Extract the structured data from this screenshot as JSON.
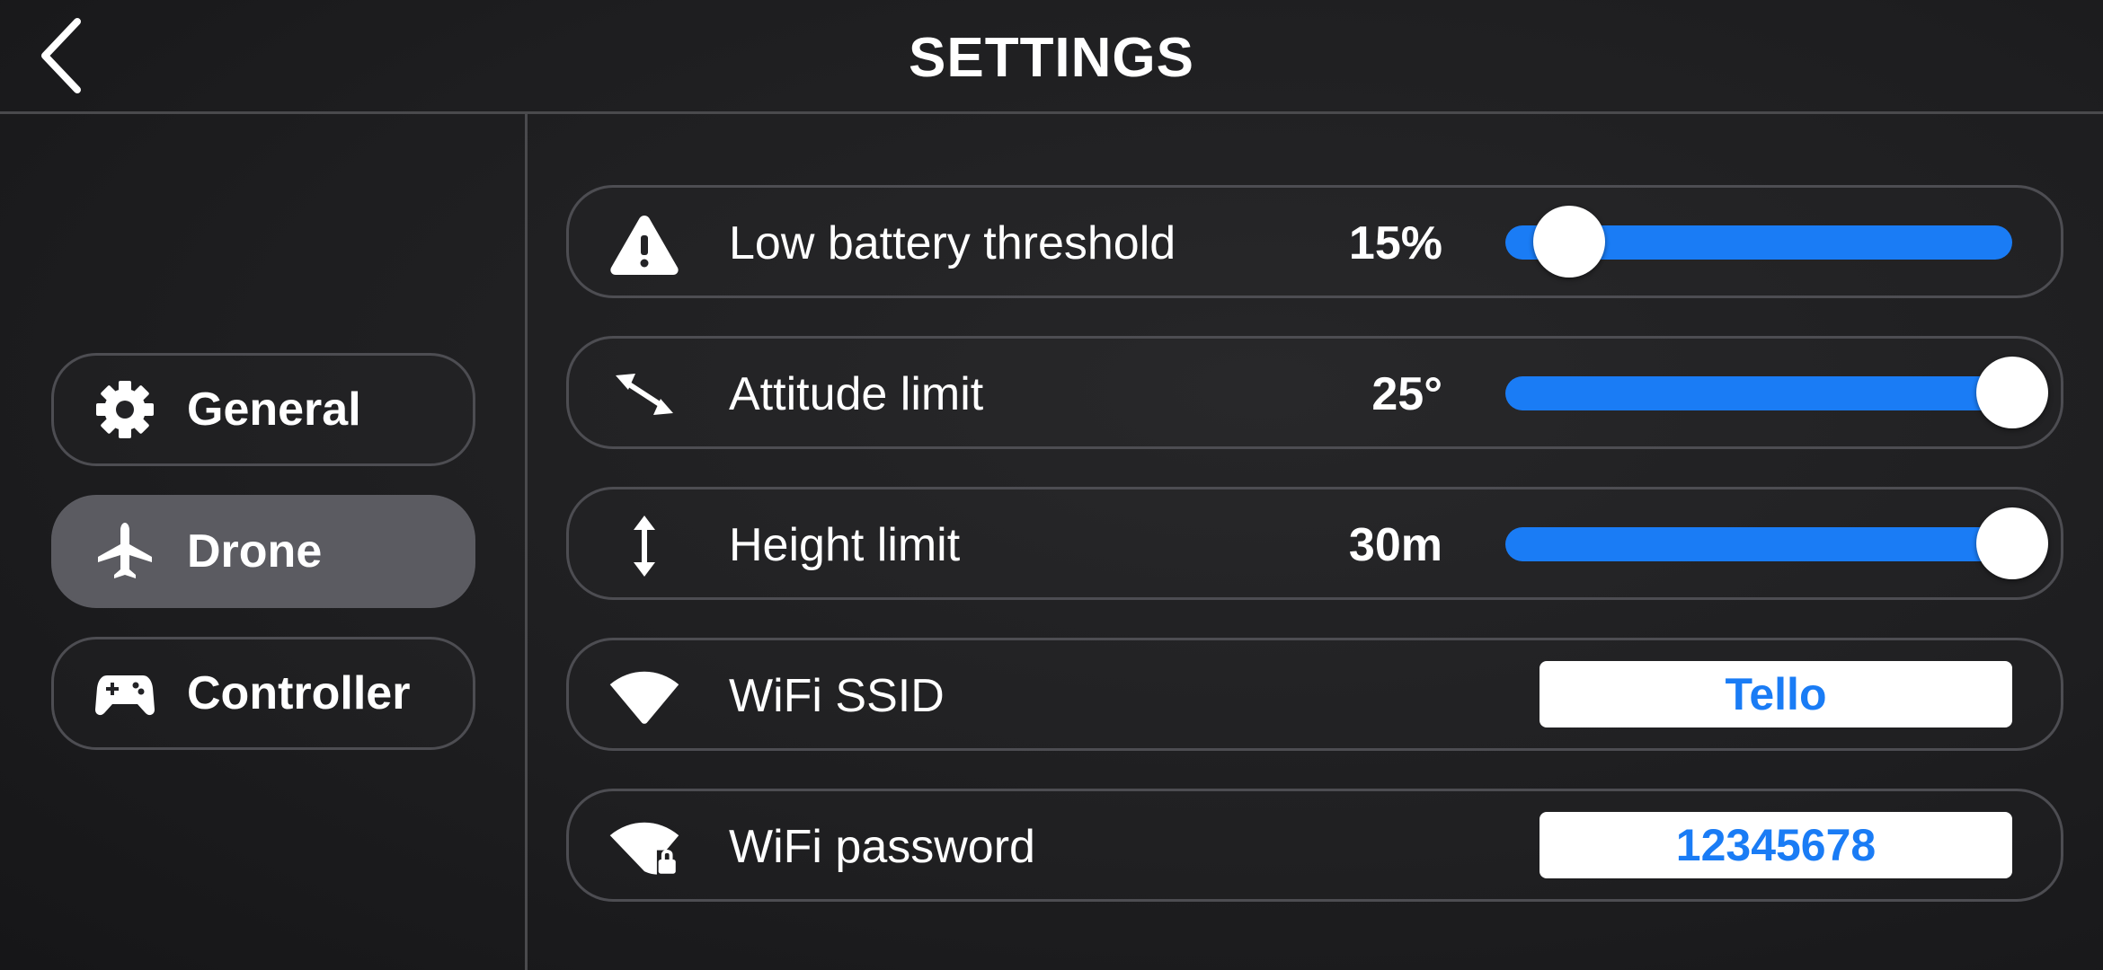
{
  "header": {
    "title": "SETTINGS",
    "back_icon": "chevron-left-icon"
  },
  "sidebar": {
    "items": [
      {
        "label": "General",
        "icon": "gear-icon",
        "active": false
      },
      {
        "label": "Drone",
        "icon": "airplane-icon",
        "active": true
      },
      {
        "label": "Controller",
        "icon": "gamepad-icon",
        "active": false
      }
    ]
  },
  "settings": {
    "low_battery": {
      "label": "Low battery threshold",
      "value": "15%",
      "icon": "warning-icon",
      "slider_fraction": 0.125
    },
    "attitude": {
      "label": "Attitude limit",
      "value": "25°",
      "icon": "diagonal-arrows-icon",
      "slider_fraction": 1.0
    },
    "height": {
      "label": "Height limit",
      "value": "30m",
      "icon": "vertical-arrows-icon",
      "slider_fraction": 1.0
    },
    "wifi_ssid": {
      "label": "WiFi SSID",
      "value": "Tello",
      "icon": "wifi-icon"
    },
    "wifi_password": {
      "label": "WiFi password",
      "value": "12345678",
      "icon": "wifi-lock-icon"
    }
  },
  "colors": {
    "accent": "#1a7cf5",
    "background": "#1e1e20",
    "active_tab": "#5b5b61",
    "border": "#4d4d52"
  }
}
